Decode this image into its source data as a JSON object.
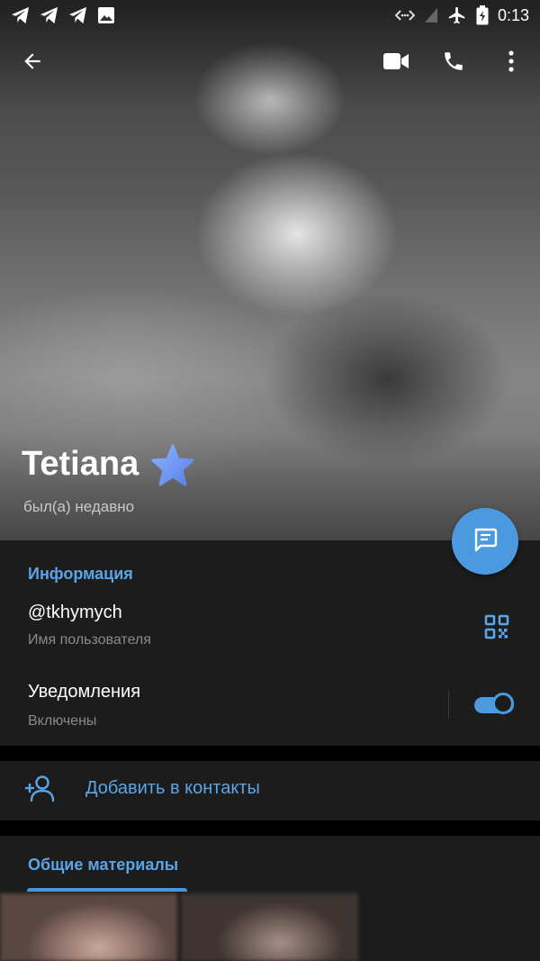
{
  "status_bar": {
    "time": "0:13",
    "left_icons": [
      "telegram-icon",
      "telegram-icon",
      "telegram-icon",
      "image-icon"
    ],
    "right_icons": [
      "data-saver-icon",
      "signal-icon",
      "airplane-icon",
      "battery-icon"
    ]
  },
  "app_bar": {
    "icons": [
      "back-arrow-icon",
      "video-call-icon",
      "phone-icon",
      "more-vert-icon"
    ]
  },
  "profile": {
    "name": "Tetiana",
    "last_seen": "был(а) недавно",
    "badge_icon": "premium-star-icon"
  },
  "info": {
    "title": "Информация",
    "username": "@tkhymych",
    "username_label": "Имя пользователя",
    "notifications_label": "Уведомления",
    "notifications_status": "Включены",
    "notifications_enabled": true
  },
  "actions": {
    "add_contact": "Добавить в контакты"
  },
  "shared_media": {
    "tab_label": "Общие материалы"
  },
  "colors": {
    "accent": "#4b9ae0",
    "accent_text": "#5aa5e8",
    "card_bg": "#1c1c1d",
    "page_bg": "#000000",
    "secondary_text": "#8a8a8a"
  }
}
